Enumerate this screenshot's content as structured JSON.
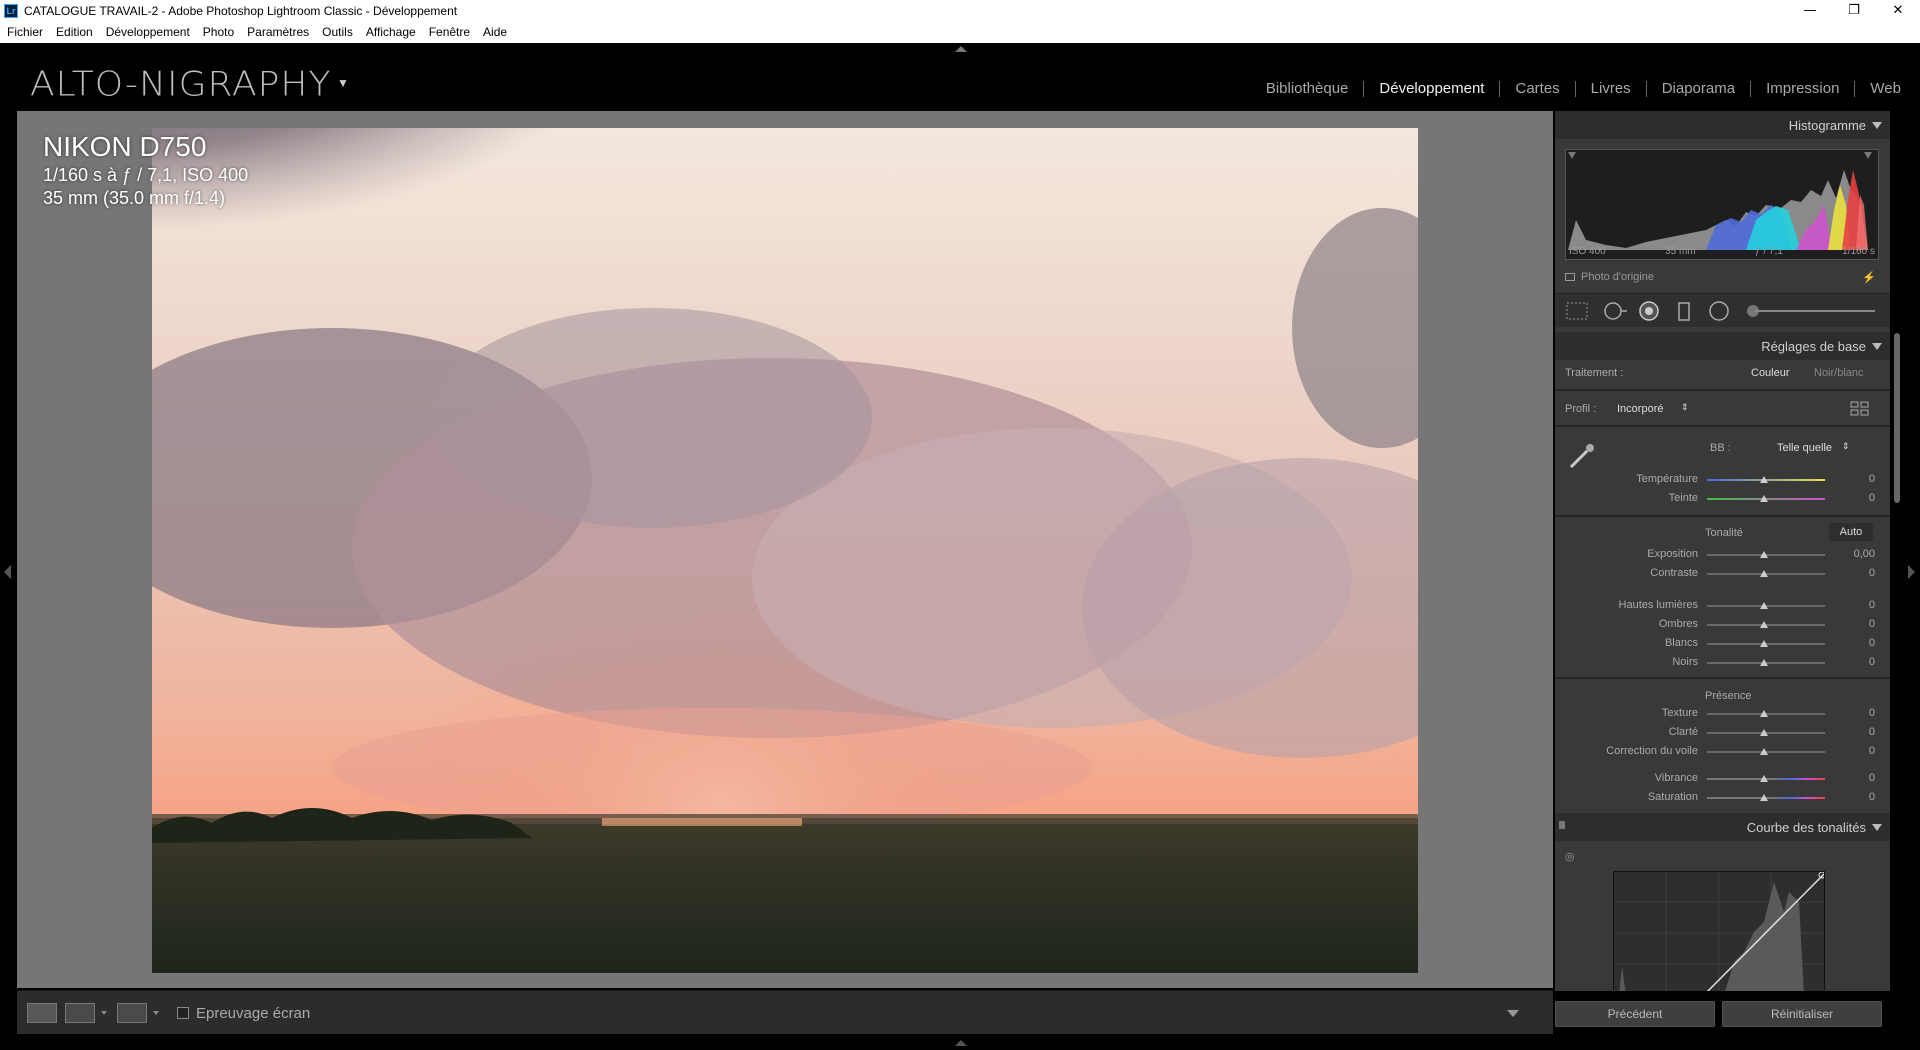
{
  "window": {
    "title": "CATALOGUE TRAVAIL-2 - Adobe Photoshop Lightroom Classic - Développement",
    "app_icon": "Lr",
    "controls": [
      "minimize-icon",
      "restore-icon",
      "close-icon"
    ]
  },
  "menu": [
    "Fichier",
    "Edition",
    "Développement",
    "Photo",
    "Paramètres",
    "Outils",
    "Affichage",
    "Fenêtre",
    "Aide"
  ],
  "identity": {
    "brand": "ALTO-NIGRAPHY",
    "arrow": "▼"
  },
  "modules": [
    {
      "label": "Bibliothèque",
      "active": false
    },
    {
      "label": "Développement",
      "active": true
    },
    {
      "label": "Cartes",
      "active": false
    },
    {
      "label": "Livres",
      "active": false
    },
    {
      "label": "Diaporama",
      "active": false
    },
    {
      "label": "Impression",
      "active": false
    },
    {
      "label": "Web",
      "active": false
    }
  ],
  "photo_info": {
    "camera": "NIKON D750",
    "exposure": "1/160 s à ƒ / 7,1, ISO 400",
    "lens": "35 mm (35.0 mm f/1.4)"
  },
  "toolbar": {
    "soft_proof_label": "Epreuvage écran"
  },
  "histogram": {
    "header": "Histogramme",
    "iso": "ISO 400",
    "focal": "35 mm",
    "aperture": "ƒ / 7,1",
    "shutter": "1/160 s",
    "original_photo": "Photo d'origine"
  },
  "basic": {
    "header": "Réglages de base",
    "treatment_label": "Traitement :",
    "color": "Couleur",
    "bw": "Noir/blanc",
    "profile_label": "Profil :",
    "profile_value": "Incorporé",
    "wb_label": "BB :",
    "wb_value": "Telle quelle",
    "temperature": {
      "label": "Température",
      "value": "0"
    },
    "tint": {
      "label": "Teinte",
      "value": "0"
    },
    "tone_label": "Tonalité",
    "auto": "Auto",
    "exposure": {
      "label": "Exposition",
      "value": "0,00"
    },
    "contrast": {
      "label": "Contraste",
      "value": "0"
    },
    "highlights": {
      "label": "Hautes lumières",
      "value": "0"
    },
    "shadows": {
      "label": "Ombres",
      "value": "0"
    },
    "whites": {
      "label": "Blancs",
      "value": "0"
    },
    "blacks": {
      "label": "Noirs",
      "value": "0"
    },
    "presence_label": "Présence",
    "texture": {
      "label": "Texture",
      "value": "0"
    },
    "clarity": {
      "label": "Clarté",
      "value": "0"
    },
    "dehaze": {
      "label": "Correction du voile",
      "value": "0"
    },
    "vibrance": {
      "label": "Vibrance",
      "value": "0"
    },
    "saturation": {
      "label": "Saturation",
      "value": "0"
    }
  },
  "tone_curve": {
    "header": "Courbe des tonalités"
  },
  "nav": {
    "previous": "Précédent",
    "reset": "Réinitialiser"
  }
}
